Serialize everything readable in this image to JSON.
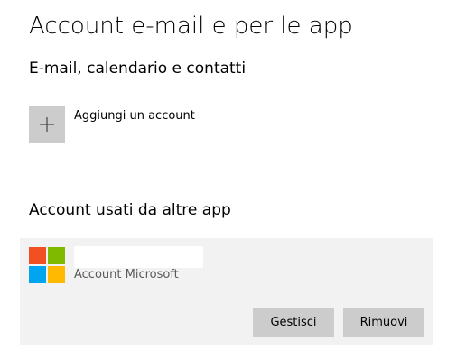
{
  "header": {
    "title": "Account e-mail e per le app"
  },
  "email_section": {
    "title": "E-mail, calendario e contatti",
    "add_account": {
      "icon": "plus-icon",
      "label": "Aggiungi un account"
    }
  },
  "other_apps_section": {
    "title": "Account usati da altre app",
    "account": {
      "icon": "microsoft-logo-icon",
      "name": "",
      "type": "Account Microsoft",
      "manage_label": "Gestisci",
      "remove_label": "Rimuovi"
    }
  },
  "colors": {
    "tile_gray": "#cccccc",
    "card_background": "#f2f2f2",
    "ms_red": "#f25022",
    "ms_green": "#7fba00",
    "ms_blue": "#00a4ef",
    "ms_yellow": "#ffb900"
  }
}
